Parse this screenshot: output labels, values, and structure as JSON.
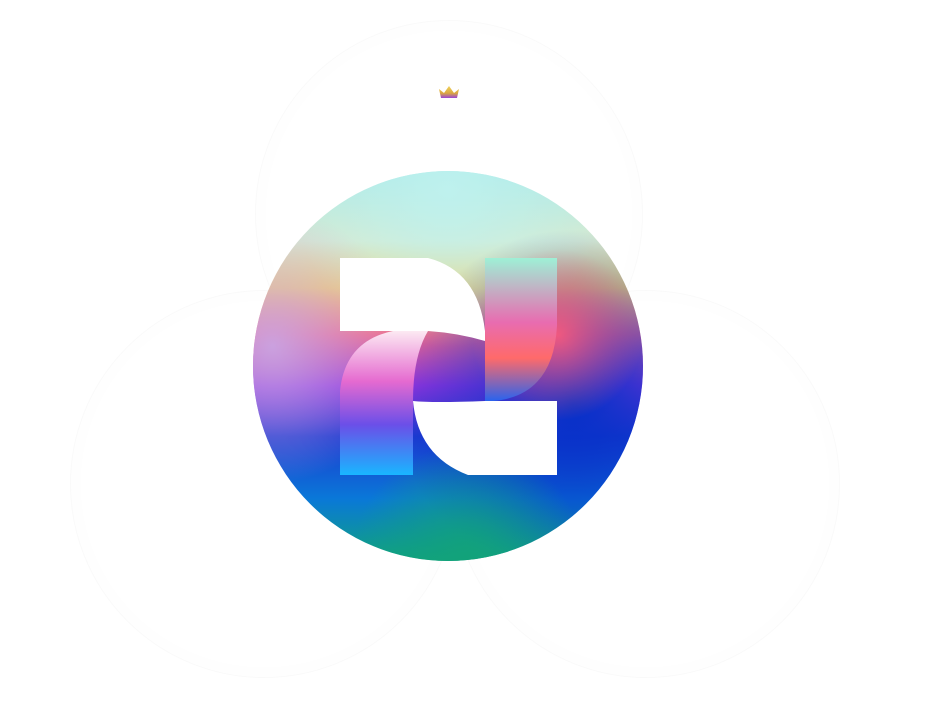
{
  "brand": {
    "icon": "logo-mark-icon",
    "accent_icon": "crown-icon",
    "colors": {
      "cyan": "#9fe8ea",
      "yellow": "#f4d66a",
      "magenta": "#e23cc0",
      "violet": "#7a2fe0",
      "blue": "#0b34c7",
      "teal": "#10a08a",
      "sky": "#18a8ff",
      "white": "#ffffff"
    }
  }
}
